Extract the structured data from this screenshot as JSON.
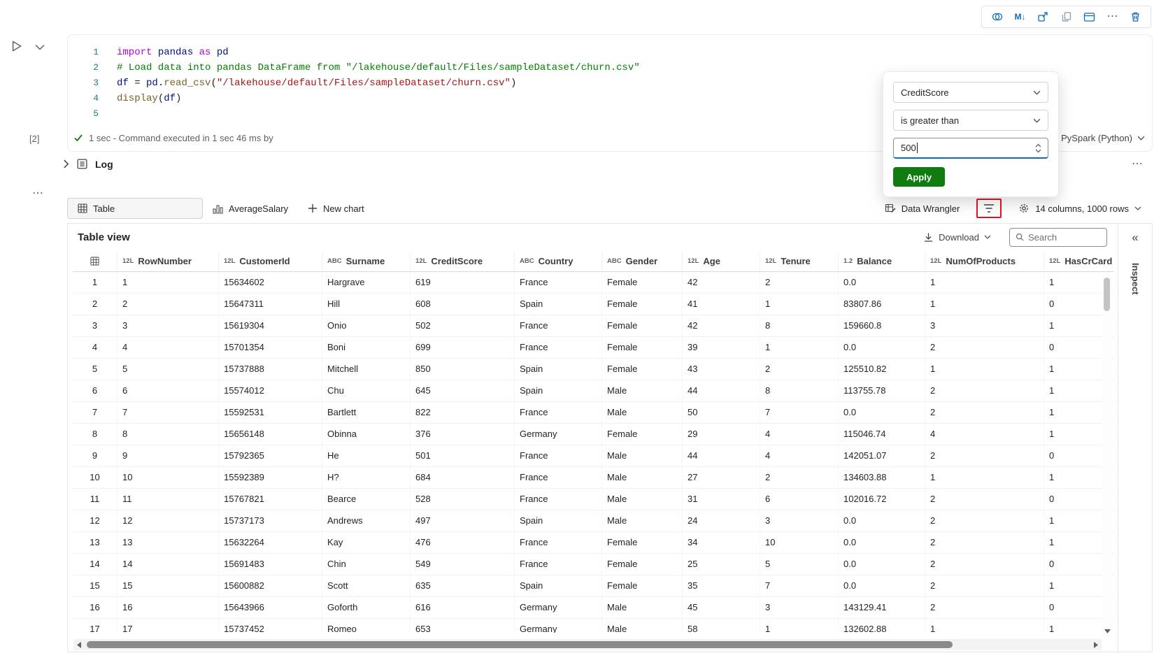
{
  "icons": {
    "more": "⋯",
    "collapse_double": "«",
    "markdown": "M↓"
  },
  "editor": {
    "lines": [
      {
        "n": "1",
        "tokens": [
          {
            "c": "kw",
            "t": "import"
          },
          {
            "c": "pl",
            "t": " "
          },
          {
            "c": "id",
            "t": "pandas"
          },
          {
            "c": "pl",
            "t": " "
          },
          {
            "c": "kw",
            "t": "as"
          },
          {
            "c": "pl",
            "t": " "
          },
          {
            "c": "id",
            "t": "pd"
          }
        ]
      },
      {
        "n": "2",
        "tokens": [
          {
            "c": "com",
            "t": "# Load data into pandas DataFrame from \"/lakehouse/default/Files/sampleDataset/churn.csv\""
          }
        ]
      },
      {
        "n": "3",
        "tokens": [
          {
            "c": "id",
            "t": "df"
          },
          {
            "c": "pl",
            "t": " = "
          },
          {
            "c": "id",
            "t": "pd"
          },
          {
            "c": "pl",
            "t": "."
          },
          {
            "c": "fn",
            "t": "read_csv"
          },
          {
            "c": "pl",
            "t": "("
          },
          {
            "c": "str",
            "t": "\"/lakehouse/default/Files/sampleDataset/churn.csv\""
          },
          {
            "c": "pl",
            "t": ")"
          }
        ]
      },
      {
        "n": "4",
        "tokens": [
          {
            "c": "fn",
            "t": "display"
          },
          {
            "c": "pl",
            "t": "("
          },
          {
            "c": "id",
            "t": "df"
          },
          {
            "c": "pl",
            "t": ")"
          }
        ]
      },
      {
        "n": "5",
        "tokens": []
      }
    ]
  },
  "status": {
    "execution_count": "[2]",
    "summary": "1 sec - Command executed in 1 sec 46 ms by",
    "kernel": "PySpark (Python)"
  },
  "log": {
    "label": "Log"
  },
  "filter_popup": {
    "field": "CreditScore",
    "operator": "is greater than",
    "value": "500",
    "apply": "Apply"
  },
  "output_tabs": {
    "table": "Table",
    "chart": "AverageSalary",
    "new_chart": "New chart",
    "data_wrangler": "Data Wrangler",
    "summary": "14 columns, 1000 rows"
  },
  "table_view": {
    "title": "Table view",
    "download": "Download",
    "search_placeholder": "Search",
    "columns": [
      {
        "type": "grid",
        "label": ""
      },
      {
        "type": "12L",
        "label": "RowNumber"
      },
      {
        "type": "12L",
        "label": "CustomerId"
      },
      {
        "type": "ABC",
        "label": "Surname"
      },
      {
        "type": "12L",
        "label": "CreditScore"
      },
      {
        "type": "ABC",
        "label": "Country"
      },
      {
        "type": "ABC",
        "label": "Gender"
      },
      {
        "type": "12L",
        "label": "Age"
      },
      {
        "type": "12L",
        "label": "Tenure"
      },
      {
        "type": "1.2",
        "label": "Balance"
      },
      {
        "type": "12L",
        "label": "NumOfProducts"
      },
      {
        "type": "12L",
        "label": "HasCrCard"
      }
    ],
    "rows": [
      [
        "1",
        "1",
        "15634602",
        "Hargrave",
        "619",
        "France",
        "Female",
        "42",
        "2",
        "0.0",
        "1",
        "1"
      ],
      [
        "2",
        "2",
        "15647311",
        "Hill",
        "608",
        "Spain",
        "Female",
        "41",
        "1",
        "83807.86",
        "1",
        "0"
      ],
      [
        "3",
        "3",
        "15619304",
        "Onio",
        "502",
        "France",
        "Female",
        "42",
        "8",
        "159660.8",
        "3",
        "1"
      ],
      [
        "4",
        "4",
        "15701354",
        "Boni",
        "699",
        "France",
        "Female",
        "39",
        "1",
        "0.0",
        "2",
        "0"
      ],
      [
        "5",
        "5",
        "15737888",
        "Mitchell",
        "850",
        "Spain",
        "Female",
        "43",
        "2",
        "125510.82",
        "1",
        "1"
      ],
      [
        "6",
        "6",
        "15574012",
        "Chu",
        "645",
        "Spain",
        "Male",
        "44",
        "8",
        "113755.78",
        "2",
        "1"
      ],
      [
        "7",
        "7",
        "15592531",
        "Bartlett",
        "822",
        "France",
        "Male",
        "50",
        "7",
        "0.0",
        "2",
        "1"
      ],
      [
        "8",
        "8",
        "15656148",
        "Obinna",
        "376",
        "Germany",
        "Female",
        "29",
        "4",
        "115046.74",
        "4",
        "1"
      ],
      [
        "9",
        "9",
        "15792365",
        "He",
        "501",
        "France",
        "Male",
        "44",
        "4",
        "142051.07",
        "2",
        "0"
      ],
      [
        "10",
        "10",
        "15592389",
        "H?",
        "684",
        "France",
        "Male",
        "27",
        "2",
        "134603.88",
        "1",
        "1"
      ],
      [
        "11",
        "11",
        "15767821",
        "Bearce",
        "528",
        "France",
        "Male",
        "31",
        "6",
        "102016.72",
        "2",
        "0"
      ],
      [
        "12",
        "12",
        "15737173",
        "Andrews",
        "497",
        "Spain",
        "Male",
        "24",
        "3",
        "0.0",
        "2",
        "1"
      ],
      [
        "13",
        "13",
        "15632264",
        "Kay",
        "476",
        "France",
        "Female",
        "34",
        "10",
        "0.0",
        "2",
        "1"
      ],
      [
        "14",
        "14",
        "15691483",
        "Chin",
        "549",
        "France",
        "Female",
        "25",
        "5",
        "0.0",
        "2",
        "0"
      ],
      [
        "15",
        "15",
        "15600882",
        "Scott",
        "635",
        "Spain",
        "Female",
        "35",
        "7",
        "0.0",
        "2",
        "1"
      ],
      [
        "16",
        "16",
        "15643966",
        "Goforth",
        "616",
        "Germany",
        "Male",
        "45",
        "3",
        "143129.41",
        "2",
        "0"
      ],
      [
        "17",
        "17",
        "15737452",
        "Romeo",
        "653",
        "Germany",
        "Male",
        "58",
        "1",
        "132602.88",
        "1",
        "1"
      ]
    ]
  },
  "inspect": {
    "label": "Inspect"
  },
  "colors": {
    "accent_blue": "#0f6cbd",
    "apply_green": "#107c10",
    "highlight_red": "#e81123",
    "success_green": "#107c10"
  }
}
